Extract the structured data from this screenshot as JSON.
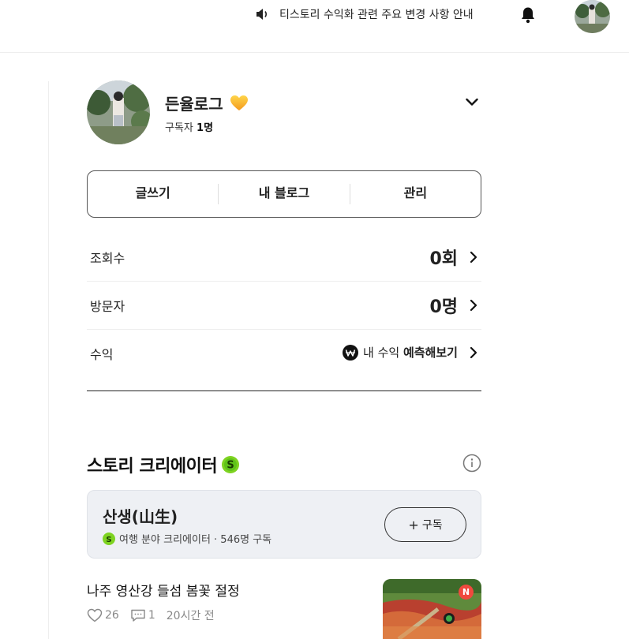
{
  "topbar": {
    "notice_text": "티스토리 수익화 관련 주요 변경 사항 안내",
    "speaker_icon": "speaker-icon",
    "bell_icon": "bell-icon"
  },
  "profile": {
    "blog_name": "든율로그",
    "subscribers_label": "구독자",
    "subscribers_count": "1명",
    "heart_color": "#f5a623"
  },
  "actions": {
    "write": "글쓰기",
    "my_blog": "내 블로그",
    "manage": "관리"
  },
  "stats": {
    "views_label": "조회수",
    "views_value": "0회",
    "visitors_label": "방문자",
    "visitors_value": "0명",
    "revenue_label": "수익",
    "revenue_prefix": "내 수익",
    "revenue_action": "예측해보기"
  },
  "creator_section": {
    "title": "스토리 크리에이터",
    "badge_letter": "S",
    "badge_color": "#7ed321",
    "card": {
      "name": "산생(山生)",
      "meta": "여행 분야 크리에이터 · 546명 구독",
      "subscribe_label": "구독"
    }
  },
  "post": {
    "title": "나주 영산강 들섬 봄꽃 절정",
    "likes": "26",
    "comments": "1",
    "time": "20시간 전",
    "new_badge": "N"
  }
}
